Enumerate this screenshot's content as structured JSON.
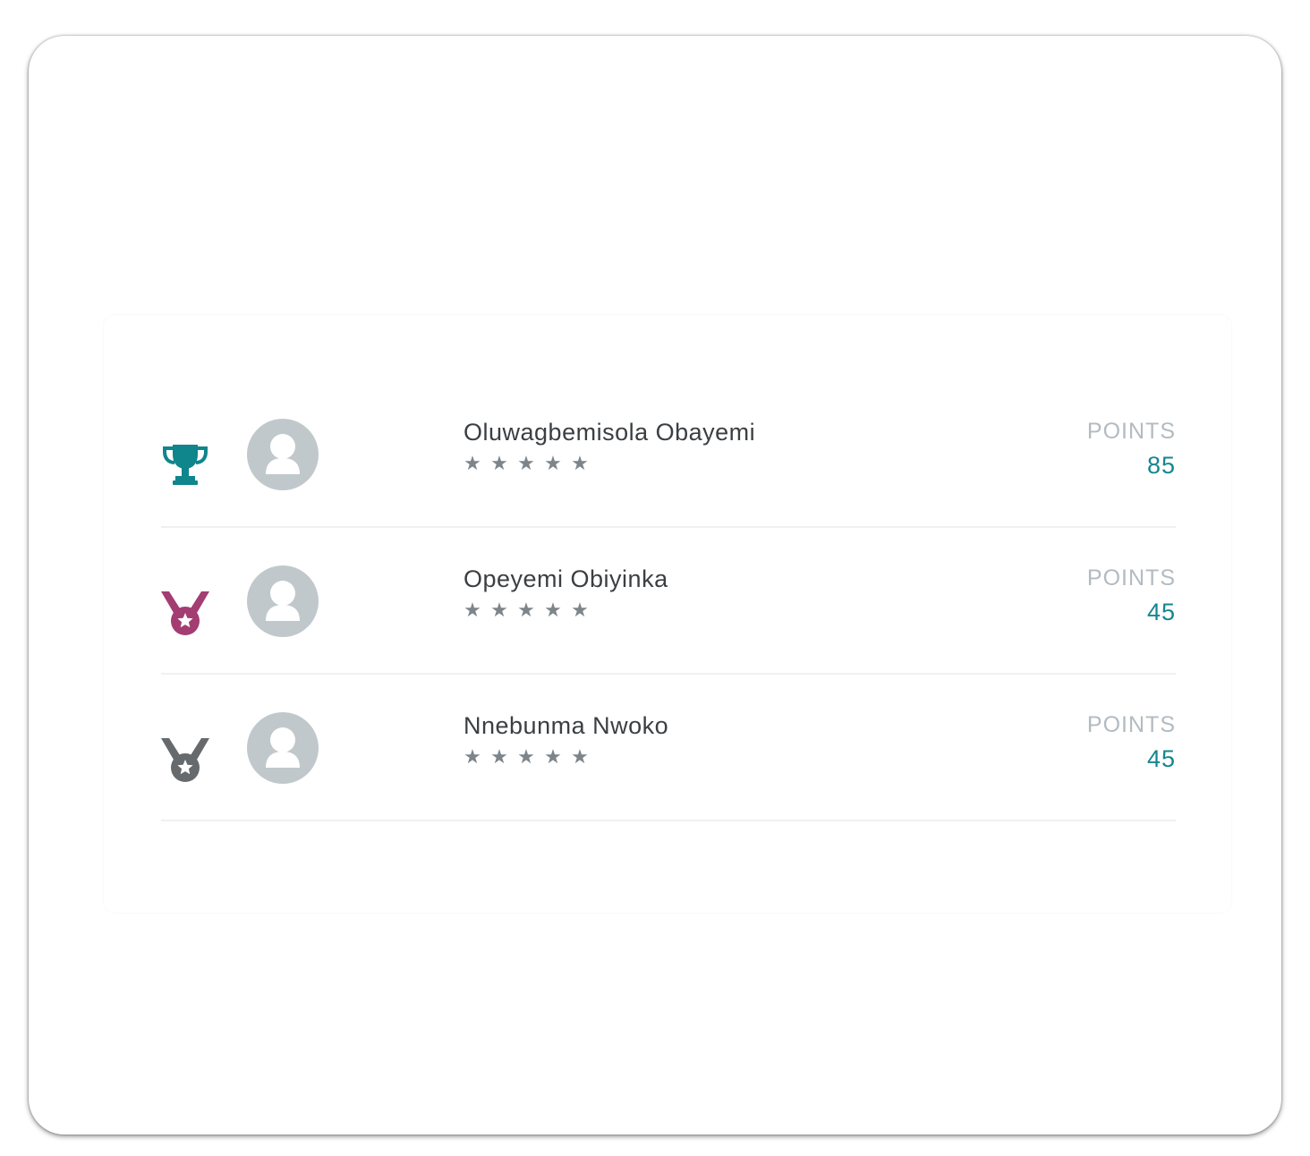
{
  "colors": {
    "gold_accent": "#0f858c",
    "silver_medal": "#a33d72",
    "bronze_medal": "#666a6d",
    "points_value": "#15868f",
    "points_label": "#b3bbc0",
    "avatar_bg": "#c0c8cc"
  },
  "leaderboard": {
    "rows": [
      {
        "rank_icon": "trophy-icon",
        "name": "Oluwagbemisola Obayemi",
        "stars": 5,
        "points_label": "POINTS",
        "points": "85"
      },
      {
        "rank_icon": "medal-icon",
        "name": "Opeyemi Obiyinka",
        "stars": 5,
        "points_label": "POINTS",
        "points": "45"
      },
      {
        "rank_icon": "medal-icon",
        "name": "Nnebunma Nwoko",
        "stars": 5,
        "points_label": "POINTS",
        "points": "45"
      }
    ]
  }
}
